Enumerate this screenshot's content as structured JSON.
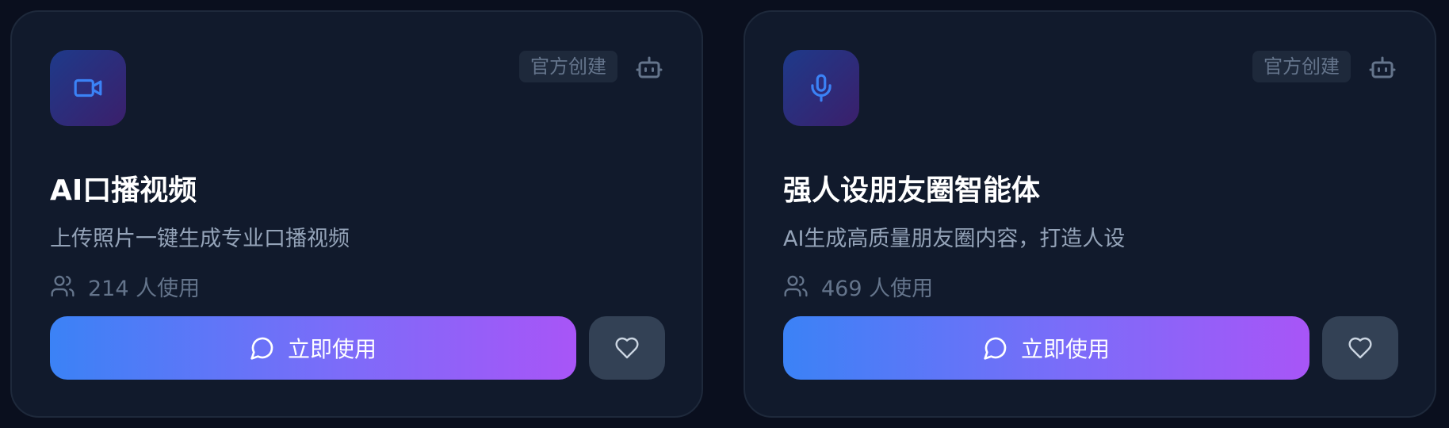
{
  "colors": {
    "card_bg": "#111a2c",
    "card_border": "#1e293b",
    "accent_blue": "#3b82f6",
    "accent_purple": "#a855f7",
    "icon_blue": "#3b82f6"
  },
  "cards": [
    {
      "icon": "video-camera-icon",
      "badge": "官方创建",
      "title": "AI口播视频",
      "description": "上传照片一键生成专业口播视频",
      "usage": "214 人使用",
      "use_button": "立即使用",
      "favorite_icon": "heart-icon"
    },
    {
      "icon": "microphone-icon",
      "badge": "官方创建",
      "title": "强人设朋友圈智能体",
      "description": "AI生成高质量朋友圈内容，打造人设",
      "usage": "469 人使用",
      "use_button": "立即使用",
      "favorite_icon": "heart-icon"
    }
  ]
}
